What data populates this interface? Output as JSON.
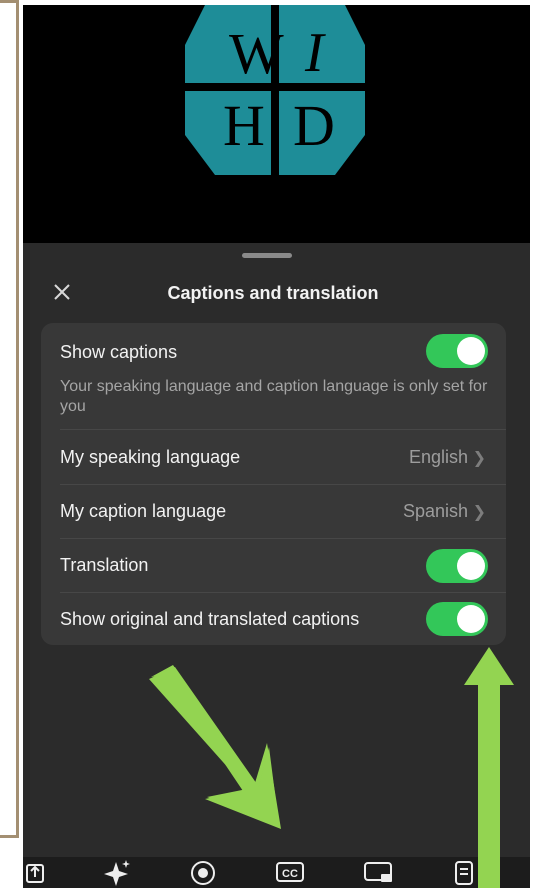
{
  "logo": {
    "letters": [
      "W",
      "I",
      "H",
      "D"
    ],
    "color": "#1e8d98"
  },
  "sheet": {
    "title": "Captions and translation",
    "rows": [
      {
        "label": "Show captions",
        "toggle": true,
        "description": "Your speaking language and caption language is only set for you"
      },
      {
        "label": "My speaking language",
        "value": "English"
      },
      {
        "label": "My caption language",
        "value": "Spanish"
      },
      {
        "label": "Translation",
        "toggle": true
      },
      {
        "label": "Show original and translated captions",
        "toggle": true
      }
    ]
  },
  "toolbar": {
    "icons": [
      "share-icon",
      "sparkle-icon",
      "record-icon",
      "cc-icon",
      "screen-icon",
      "notes-icon"
    ],
    "cc_label": "CC"
  },
  "colors": {
    "toggle_on": "#33c759",
    "arrow": "#93d451",
    "sheet_bg": "#2b2b2b",
    "card_bg": "#383838"
  }
}
